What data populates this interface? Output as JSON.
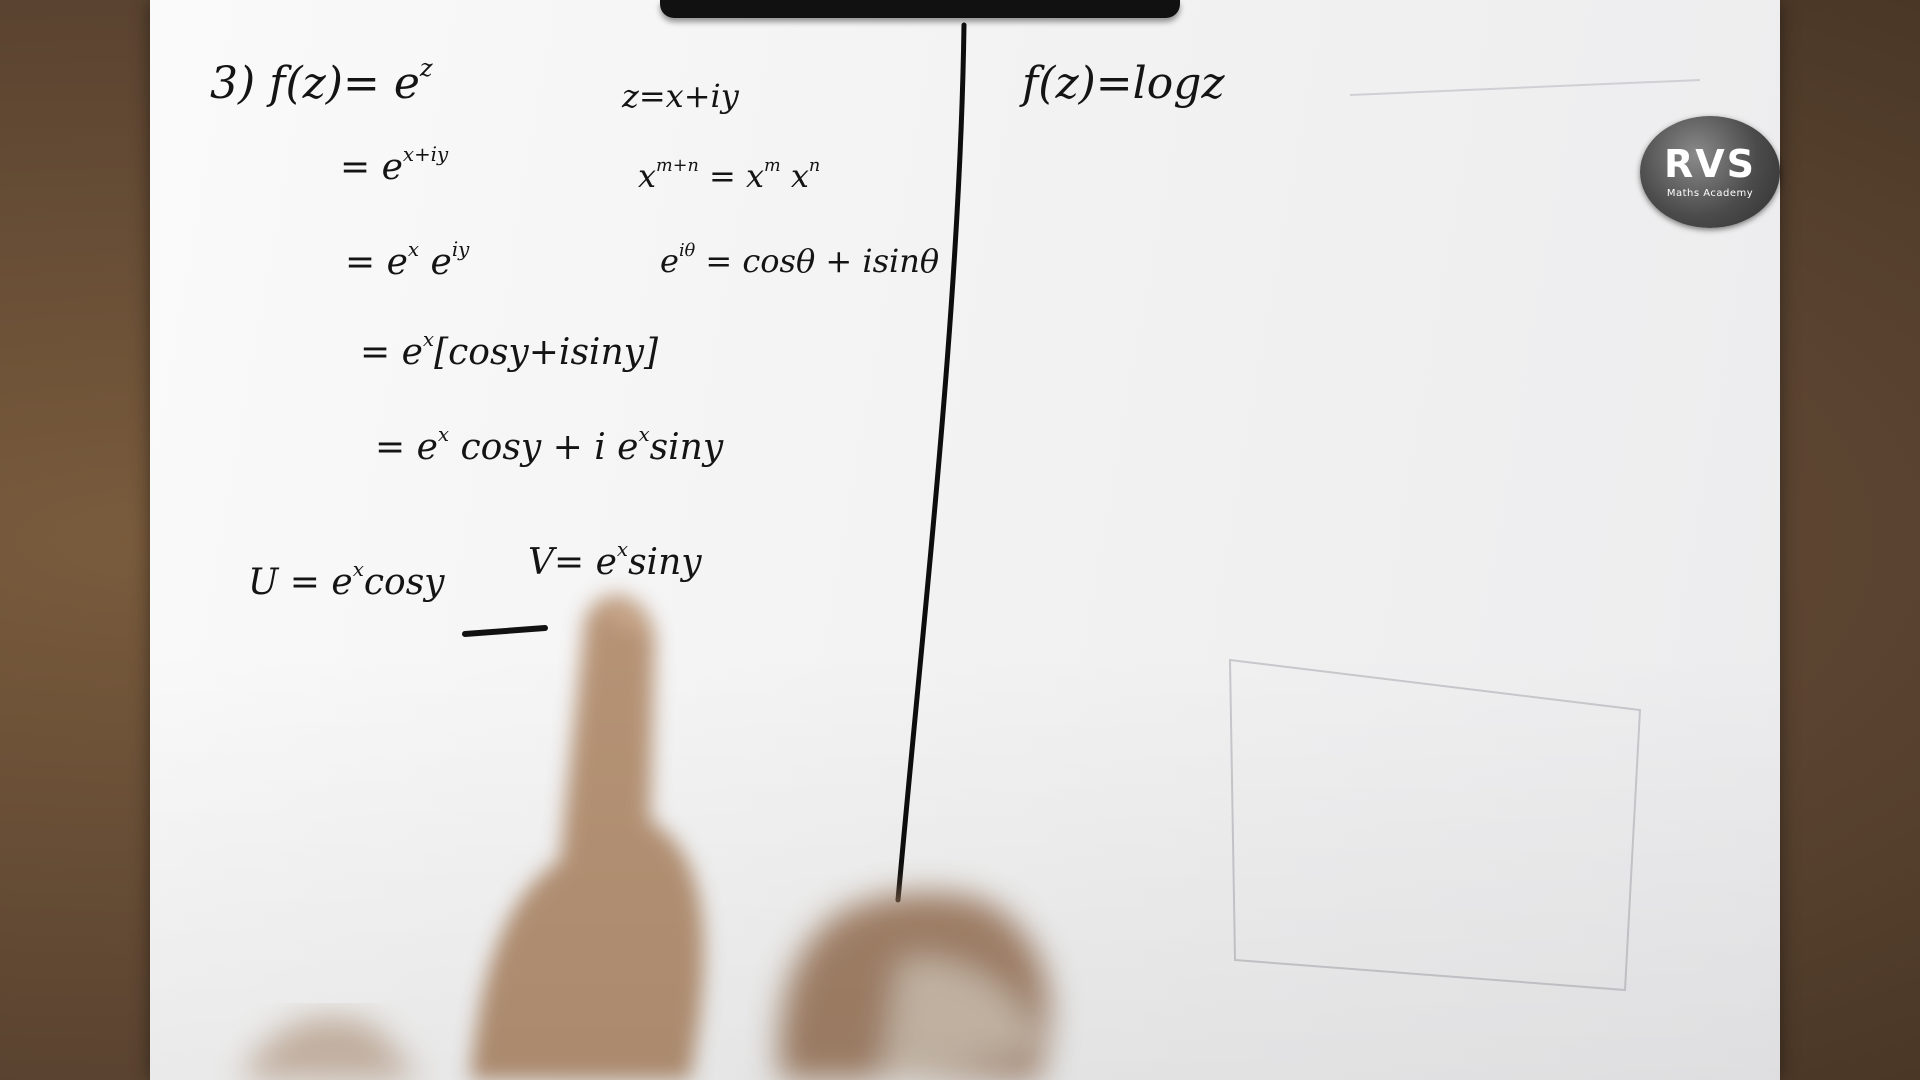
{
  "left_column": {
    "problem_number": "3)",
    "function_def": "f(z)= e",
    "function_exp": "z",
    "step1_base": "= e",
    "step1_exp": "x+iy",
    "step2_a": "= e",
    "step2_a_exp": "x",
    "step2_b": " e",
    "step2_b_exp": "iy",
    "step3_base": "= e",
    "step3_exp": "x",
    "step3_rest": "[cosy+isiny]",
    "step4_base": "= e",
    "step4_exp1": "x",
    "step4_mid": " cosy + i e",
    "step4_exp2": "x",
    "step4_end": "siny",
    "u_label": "U = e",
    "u_exp": "x",
    "u_rest": "cosy",
    "v_label": "V= e",
    "v_exp": "x",
    "v_rest": "siny"
  },
  "notes": {
    "z_def": "z=x+iy",
    "power_rule_base1": "x",
    "power_rule_exp1": "m+n",
    "power_rule_mid": " = x",
    "power_rule_exp2": "m",
    "power_rule_base3": " x",
    "power_rule_exp3": "n",
    "euler_base": "e",
    "euler_exp": "iθ",
    "euler_rest": " = cosθ + isinθ"
  },
  "right_column": {
    "function_def": "f(z)=logz"
  },
  "logo": {
    "main": "RVS",
    "sub": "Maths Academy"
  },
  "colors": {
    "ink": "#141414",
    "paper": "#f5f5f5",
    "table": "#5a4330",
    "skin": "#b08a6a"
  }
}
